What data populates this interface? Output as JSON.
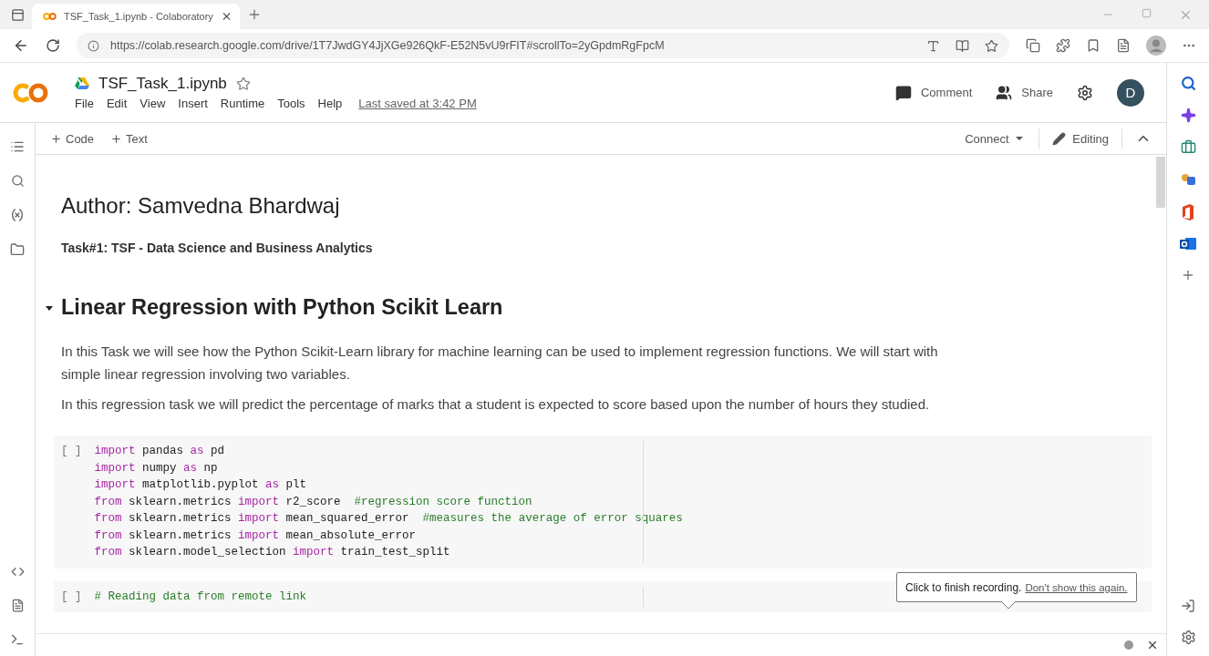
{
  "browser": {
    "tab": {
      "title": "TSF_Task_1.ipynb - Colaboratory",
      "selected": true
    },
    "url": "https://colab.research.google.com/drive/1T7JwdGY4JjXGe926QkF-E52N5vU9rFIT#scrollTo=2yGpdmRgFpcM"
  },
  "notebook": {
    "title": "TSF_Task_1.ipynb",
    "menu": [
      "File",
      "Edit",
      "View",
      "Insert",
      "Runtime",
      "Tools",
      "Help"
    ],
    "last_saved": "Last saved at 3:42 PM",
    "actions": [
      {
        "kind": "comment",
        "label": "Comment"
      },
      {
        "kind": "share",
        "label": "Share"
      }
    ],
    "avatar": "D"
  },
  "toolbar": {
    "add": [
      "Code",
      "Text"
    ],
    "connect": "Connect",
    "mode": "Editing"
  },
  "cells": [
    {
      "kind": "heading",
      "text": "Author: Samvedna Bhardwaj"
    },
    {
      "kind": "bold",
      "text": "Task#1: TSF - Data Science and Business Analytics"
    },
    {
      "kind": "section",
      "text": "Linear Regression with Python Scikit Learn",
      "expanded": true
    },
    {
      "kind": "paragraph",
      "text": "In this Task we will see how the Python Scikit-Learn library for machine learning can be used to implement regression functions. We will start with simple linear regression involving two variables."
    },
    {
      "kind": "paragraph",
      "text": "In this regression task we will predict the percentage of marks that a student is expected to score based upon the number of hours they studied."
    },
    {
      "kind": "code",
      "prompt": "[ ]",
      "lines": [
        [
          {
            "kind": "kw",
            "t": "import"
          },
          {
            "kind": "tx",
            "t": " pandas "
          },
          {
            "kind": "kw",
            "t": "as"
          },
          {
            "kind": "tx",
            "t": " pd"
          }
        ],
        [
          {
            "kind": "kw",
            "t": "import"
          },
          {
            "kind": "tx",
            "t": " numpy "
          },
          {
            "kind": "kw",
            "t": "as"
          },
          {
            "kind": "tx",
            "t": " np"
          }
        ],
        [
          {
            "kind": "kw",
            "t": "import"
          },
          {
            "kind": "tx",
            "t": " matplotlib.pyplot "
          },
          {
            "kind": "kw",
            "t": "as"
          },
          {
            "kind": "tx",
            "t": " plt"
          }
        ],
        [
          {
            "kind": "kw",
            "t": "from"
          },
          {
            "kind": "tx",
            "t": " sklearn.metrics "
          },
          {
            "kind": "kw",
            "t": "import"
          },
          {
            "kind": "tx",
            "t": " r2_score  "
          },
          {
            "kind": "cm",
            "t": "#regression score function"
          }
        ],
        [
          {
            "kind": "kw",
            "t": "from"
          },
          {
            "kind": "tx",
            "t": " sklearn.metrics "
          },
          {
            "kind": "kw",
            "t": "import"
          },
          {
            "kind": "tx",
            "t": " mean_squared_error  "
          },
          {
            "kind": "cm",
            "t": "#measures the average of error squares"
          }
        ],
        [
          {
            "kind": "kw",
            "t": "from"
          },
          {
            "kind": "tx",
            "t": " sklearn.metrics "
          },
          {
            "kind": "kw",
            "t": "import"
          },
          {
            "kind": "tx",
            "t": " mean_absolute_error"
          }
        ],
        [
          {
            "kind": "kw",
            "t": "from"
          },
          {
            "kind": "tx",
            "t": " sklearn.model_selection "
          },
          {
            "kind": "kw",
            "t": "import"
          },
          {
            "kind": "tx",
            "t": " train_test_split"
          }
        ]
      ]
    },
    {
      "kind": "code",
      "prompt": "[ ]",
      "lines": [
        [
          {
            "kind": "cm",
            "t": "# Reading data from remote link"
          }
        ]
      ]
    }
  ],
  "tooltip": {
    "text": "Click to finish recording.",
    "link": "Don't show this again."
  }
}
